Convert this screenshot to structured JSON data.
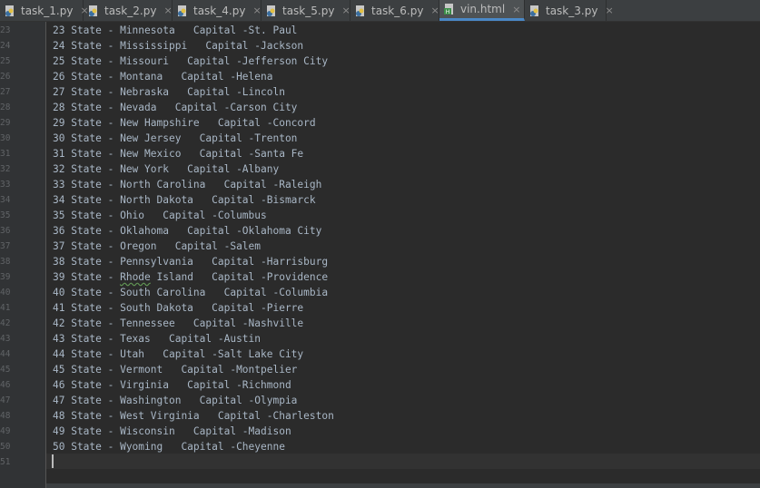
{
  "tabs": [
    {
      "label": "task_1.py",
      "icon": "python-file-icon",
      "active": false
    },
    {
      "label": "task_2.py",
      "icon": "python-file-icon",
      "active": false
    },
    {
      "label": "task_4.py",
      "icon": "python-file-icon",
      "active": false
    },
    {
      "label": "task_5.py",
      "icon": "python-file-icon",
      "active": false
    },
    {
      "label": "task_6.py",
      "icon": "python-file-icon",
      "active": false
    },
    {
      "label": "vin.html",
      "icon": "html-file-icon",
      "active": true
    },
    {
      "label": "task_3.py",
      "icon": "python-file-icon",
      "active": false
    }
  ],
  "close_glyph": "×",
  "colors": {
    "editor_bg": "#2b2b2b",
    "gutter_bg": "#313335",
    "tabbar_bg": "#3c3f41",
    "text": "#a9b7c6",
    "line_number": "#606366",
    "active_tab_underline": "#4a88c7",
    "python_icon": "#3b6fa0",
    "html_icon": "#3d8f4a"
  },
  "editor": {
    "lines": [
      {
        "n": "23",
        "text": "23 State - Minnesota   Capital -St. Paul"
      },
      {
        "n": "24",
        "text": "24 State - Mississippi   Capital -Jackson"
      },
      {
        "n": "25",
        "text": "25 State - Missouri   Capital -Jefferson City"
      },
      {
        "n": "26",
        "text": "26 State - Montana   Capital -Helena"
      },
      {
        "n": "27",
        "text": "27 State - Nebraska   Capital -Lincoln"
      },
      {
        "n": "28",
        "text": "28 State - Nevada   Capital -Carson City"
      },
      {
        "n": "29",
        "text": "29 State - New Hampshire   Capital -Concord"
      },
      {
        "n": "30",
        "text": "30 State - New Jersey   Capital -Trenton"
      },
      {
        "n": "31",
        "text": "31 State - New Mexico   Capital -Santa Fe"
      },
      {
        "n": "32",
        "text": "32 State - New York   Capital -Albany"
      },
      {
        "n": "33",
        "text": "33 State - North Carolina   Capital -Raleigh"
      },
      {
        "n": "34",
        "text": "34 State - North Dakota   Capital -Bismarck"
      },
      {
        "n": "35",
        "text": "35 State - Ohio   Capital -Columbus"
      },
      {
        "n": "36",
        "text": "36 State - Oklahoma   Capital -Oklahoma City"
      },
      {
        "n": "37",
        "text": "37 State - Oregon   Capital -Salem"
      },
      {
        "n": "38",
        "text": "38 State - Pennsylvania   Capital -Harrisburg"
      },
      {
        "n": "39",
        "text": "39 State - Rhode Island   Capital -Providence"
      },
      {
        "n": "40",
        "text": "40 State - South Carolina   Capital -Columbia"
      },
      {
        "n": "41",
        "text": "41 State - South Dakota   Capital -Pierre"
      },
      {
        "n": "42",
        "text": "42 State - Tennessee   Capital -Nashville"
      },
      {
        "n": "43",
        "text": "43 State - Texas   Capital -Austin"
      },
      {
        "n": "44",
        "text": "44 State - Utah   Capital -Salt Lake City"
      },
      {
        "n": "45",
        "text": "45 State - Vermont   Capital -Montpelier"
      },
      {
        "n": "46",
        "text": "46 State - Virginia   Capital -Richmond"
      },
      {
        "n": "47",
        "text": "47 State - Washington   Capital -Olympia"
      },
      {
        "n": "48",
        "text": "48 State - West Virginia   Capital -Charleston"
      },
      {
        "n": "49",
        "text": "49 State - Wisconsin   Capital -Madison"
      },
      {
        "n": "50",
        "text": "50 State - Wyoming   Capital -Cheyenne"
      },
      {
        "n": "51",
        "text": ""
      }
    ]
  }
}
